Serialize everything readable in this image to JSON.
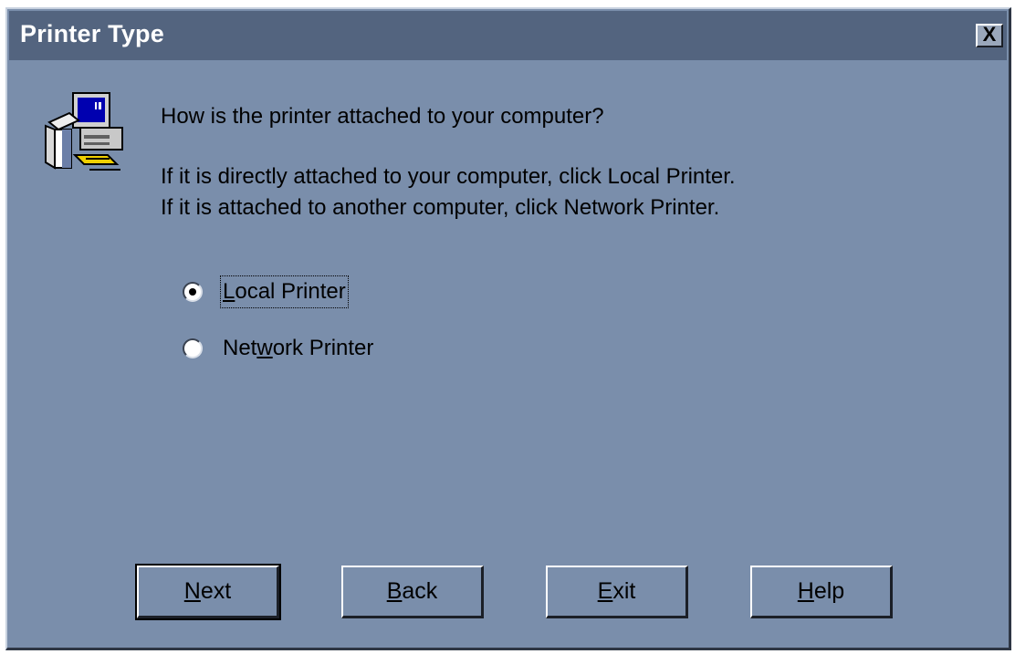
{
  "window": {
    "title": "Printer Type",
    "close_symbol": "X"
  },
  "icon": {
    "name": "computer-printer-icon"
  },
  "content": {
    "question": "How is the printer attached to your computer?",
    "line1": "If it is directly attached to your computer, click Local Printer.",
    "line2": "If it is attached to another computer, click Network Printer."
  },
  "options": [
    {
      "label": "Local Printer",
      "mnemonic": "L",
      "rest": "ocal Printer",
      "selected": true
    },
    {
      "label": "Network Printer",
      "prefix": "Net",
      "mnemonic": "w",
      "rest": "ork Printer",
      "selected": false
    }
  ],
  "buttons": {
    "next": {
      "label": "Next",
      "mnemonic": "N",
      "rest": "ext"
    },
    "back": {
      "label": "Back",
      "mnemonic": "B",
      "rest": "ack"
    },
    "exit": {
      "label": "Exit",
      "mnemonic": "E",
      "rest": "xit"
    },
    "help": {
      "label": "Help",
      "mnemonic": "H",
      "rest": "elp"
    }
  },
  "colors": {
    "dialog_bg": "#7a8eab",
    "titlebar_bg": "#53647f",
    "title_text": "#ffffff"
  }
}
